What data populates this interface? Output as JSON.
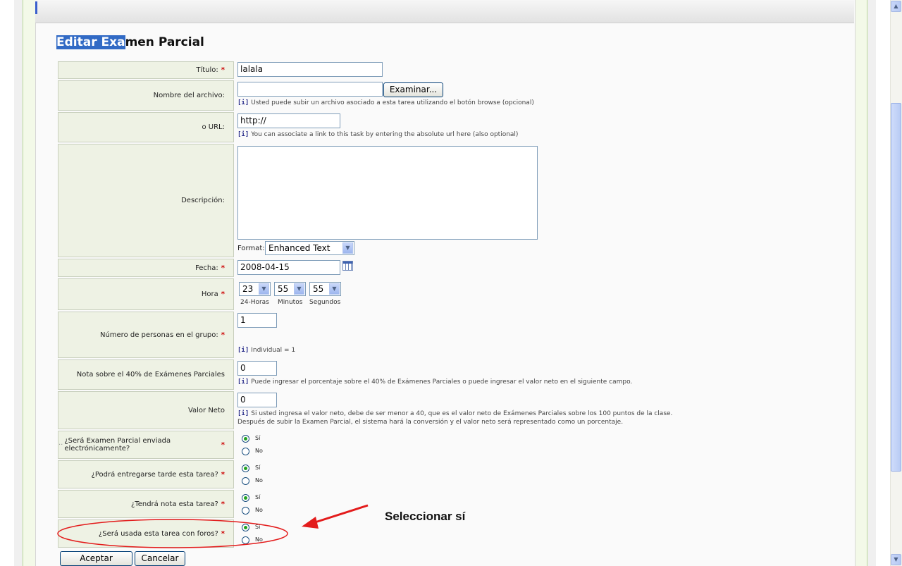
{
  "form": {
    "title_selected": "Editar Exa",
    "title_rest": "men Parcial",
    "required_mark": "*"
  },
  "fields": {
    "titulo": {
      "label": "Título:",
      "value": "lalala"
    },
    "archivo": {
      "label": "Nombre del archivo:",
      "value": "",
      "button": "Examinar...",
      "hint": "Usted puede subir un archivo asociado a esta tarea utilizando el botón browse (opcional)"
    },
    "url": {
      "label": "o URL:",
      "value": "http://",
      "hint": "You can associate a link to this task by entering the absolute url here (also optional)"
    },
    "descripcion": {
      "label": "Descripción:",
      "format_label": "Format:",
      "format_value": "Enhanced Text"
    },
    "fecha": {
      "label": "Fecha:",
      "value": "2008-04-15"
    },
    "hora": {
      "label": "Hora",
      "hours": "23",
      "minutes": "55",
      "seconds": "55",
      "hours_label": "24-Horas",
      "minutes_label": "Minutos",
      "seconds_label": "Segundos"
    },
    "personas": {
      "label": "Número de personas en el grupo:",
      "value": "1",
      "hint": "Individual = 1"
    },
    "nota": {
      "label": "Nota sobre el 40% de Exámenes Parciales",
      "value": "0",
      "hint": "Puede ingresar el porcentaje sobre el 40% de Exámenes Parciales o puede ingresar el valor neto en el siguiente campo."
    },
    "valor": {
      "label": "Valor Neto",
      "value": "0",
      "hint": "Si usted ingresa el valor neto, debe de ser menor a 40, que es el valor neto de Exámenes Parciales sobre los 100 puntos de la clase.",
      "hint2": "Después de subir la Examen Parcial, el sistema hará la conversión y el valor neto será representado como un porcentaje."
    },
    "electronica": {
      "label": "¿Será Examen Parcial enviada electrónicamente?",
      "prefix": "··",
      "selected": "si"
    },
    "tarde": {
      "label": "¿Podrá entregarse tarde esta tarea?",
      "selected": "si"
    },
    "tendra_nota": {
      "label": "¿Tendrá nota esta tarea?",
      "selected": "si"
    },
    "foros": {
      "label": "¿Será usada esta tarea con foros?",
      "selected": "si"
    }
  },
  "radio_labels": {
    "yes": "Sí",
    "no": "No"
  },
  "info_marker": "[i]",
  "buttons": {
    "accept": "Aceptar",
    "cancel": "Cancelar"
  },
  "annotation": {
    "text": "Seleccionar sí",
    "color": "#e31b1b"
  },
  "icons": {
    "calendar": "calendar-icon",
    "dropdown": "chevron-down-icon"
  }
}
